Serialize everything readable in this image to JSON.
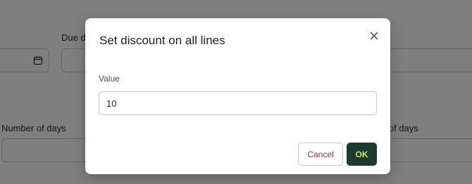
{
  "background_form": {
    "due_date_label": "Due date",
    "number_of_days_label": "Number of days",
    "number_of_days_label_right": "Number of days"
  },
  "dialog": {
    "title": "Set discount on all lines",
    "close_icon": "close-icon",
    "value_label": "Value",
    "value": "10",
    "cancel_label": "Cancel",
    "ok_label": "OK"
  },
  "colors": {
    "ok_bg": "#1d3a2c",
    "ok_text": "#c8e47a",
    "cancel_text": "#b3262e",
    "overlay": "rgba(0,0,0,0.5)"
  }
}
